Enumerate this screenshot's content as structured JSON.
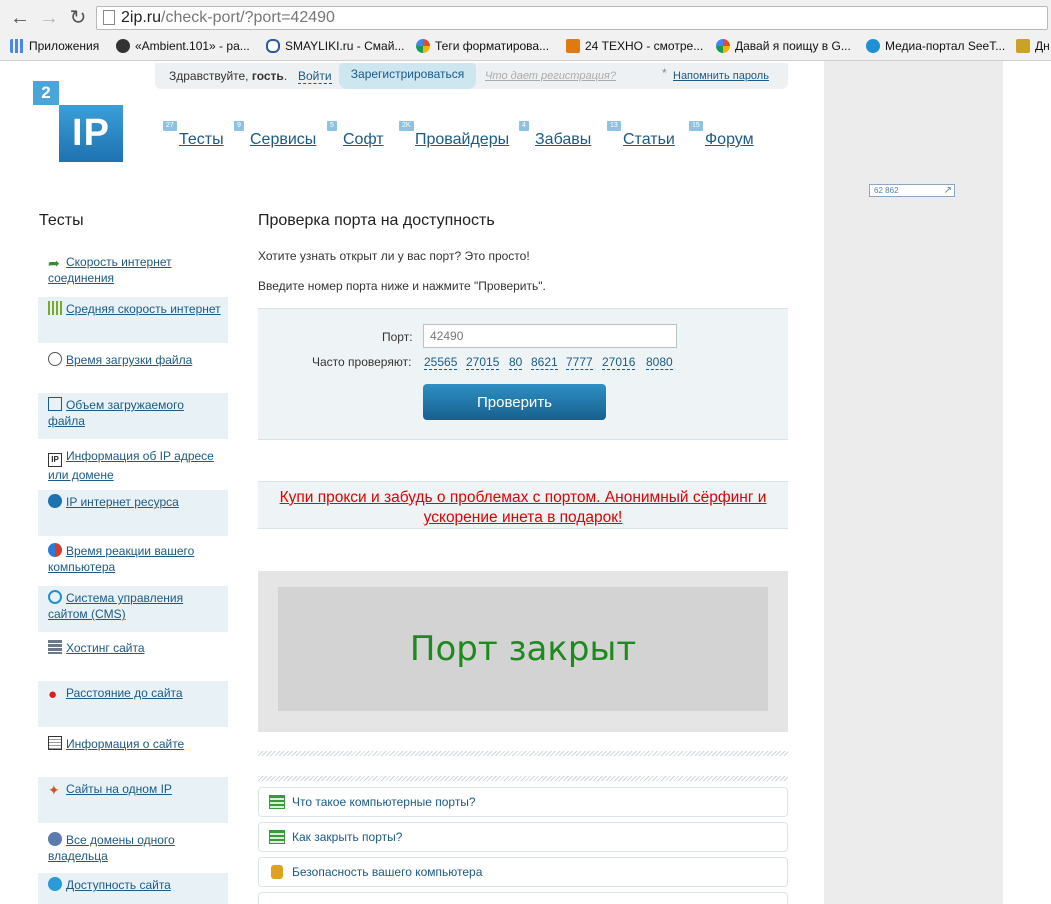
{
  "browser": {
    "url_host": "2ip.ru",
    "url_path": "/check-port/?port=42490",
    "bookmarks": [
      {
        "label": "Приложения",
        "icon": "apps-grid-icon",
        "color": "#4a87e8"
      },
      {
        "label": "«Ambient.101» - ра...",
        "icon": "play-icon",
        "color": "#333333"
      },
      {
        "label": "SMAYLIKI.ru - Смай...",
        "icon": "smiley-icon",
        "color": "#2a5a9a"
      },
      {
        "label": "Теги форматирова...",
        "icon": "google-icon",
        "color": "#dd4b39"
      },
      {
        "label": "24 ТЕХНО - смотре...",
        "icon": "tv-icon",
        "color": "#e07a10"
      },
      {
        "label": "Давай я поищу в G...",
        "icon": "google-icon",
        "color": "#dd4b39"
      },
      {
        "label": "Медиа-портал SeeT...",
        "icon": "seet-icon",
        "color": "#1e90d6"
      },
      {
        "label": "Дн",
        "icon": "folder-icon",
        "color": "#c9a227"
      }
    ]
  },
  "userbar": {
    "hello_prefix": "Здравствуйте, ",
    "hello_name": "гость",
    "hello_suffix": ".",
    "login": "Войти",
    "register": "Зарегистрироваться",
    "why": "Что дает регистрация?",
    "star": "*",
    "remind": "Напомнить пароль"
  },
  "logo": {
    "top": "2",
    "main": "IP"
  },
  "nav": [
    {
      "count": "27",
      "label": "Тесты"
    },
    {
      "count": "9",
      "label": "Сервисы"
    },
    {
      "count": "5",
      "label": "Софт"
    },
    {
      "count": "2K",
      "label": "Провайдеры"
    },
    {
      "count": "4",
      "label": "Забавы"
    },
    {
      "count": "13",
      "label": "Статьи"
    },
    {
      "count": "15",
      "label": "Форум"
    }
  ],
  "counter": {
    "value": "62 862"
  },
  "sidebar": {
    "title": "Тесты",
    "items": [
      {
        "label": "Скорость интернет соединения",
        "icon": "speed-arrow-icon"
      },
      {
        "label": "Средняя скорость интернет",
        "icon": "speed-bars-icon"
      },
      {
        "label": "Время загрузки файла",
        "icon": "clock-icon"
      },
      {
        "label": "Объем загружаемого файла",
        "icon": "file-size-icon"
      },
      {
        "label": "Информация об IP адресе или домене",
        "icon": "ip-info-icon"
      },
      {
        "label": "IP интернет ресурса",
        "icon": "ip-globe-icon"
      },
      {
        "label": "Время реакции вашего компьютера",
        "icon": "reaction-icon"
      },
      {
        "label": "Система управления сайтом (CMS)",
        "icon": "cms-gear-icon"
      },
      {
        "label": "Хостинг сайта",
        "icon": "server-icon"
      },
      {
        "label": "Расстояние до сайта",
        "icon": "map-pin-icon"
      },
      {
        "label": "Информация о сайте",
        "icon": "document-icon"
      },
      {
        "label": "Сайты на одном IP",
        "icon": "network-icon"
      },
      {
        "label": "Все домены одного владельца",
        "icon": "owner-globe-icon"
      },
      {
        "label": "Доступность сайта",
        "icon": "availability-icon"
      }
    ]
  },
  "content": {
    "title": "Проверка порта на доступность",
    "p1": "Хотите узнать открыт ли у вас порт? Это просто!",
    "p2": "Введите номер порта ниже и нажмите \"Проверить\".",
    "form": {
      "port_label": "Порт:",
      "port_value": "42490",
      "often_label": "Часто проверяют:",
      "common_ports": [
        "25565",
        "27015",
        "80",
        "8621",
        "7777",
        "27016",
        "8080"
      ],
      "submit": "Проверить"
    },
    "promo": "Купи прокси и забудь о проблемах с портом. Анонимный сёрфинг и ускорение инета в подарок!",
    "result": "Порт закрыт",
    "result_color": "#1c8a1c",
    "faq": [
      {
        "label": "Что такое компьютерные порты?",
        "icon": "doc-green-icon"
      },
      {
        "label": "Как закрыть порты?",
        "icon": "doc-green-icon"
      },
      {
        "label": "Безопасность вашего компьютера",
        "icon": "lock-icon"
      }
    ]
  }
}
